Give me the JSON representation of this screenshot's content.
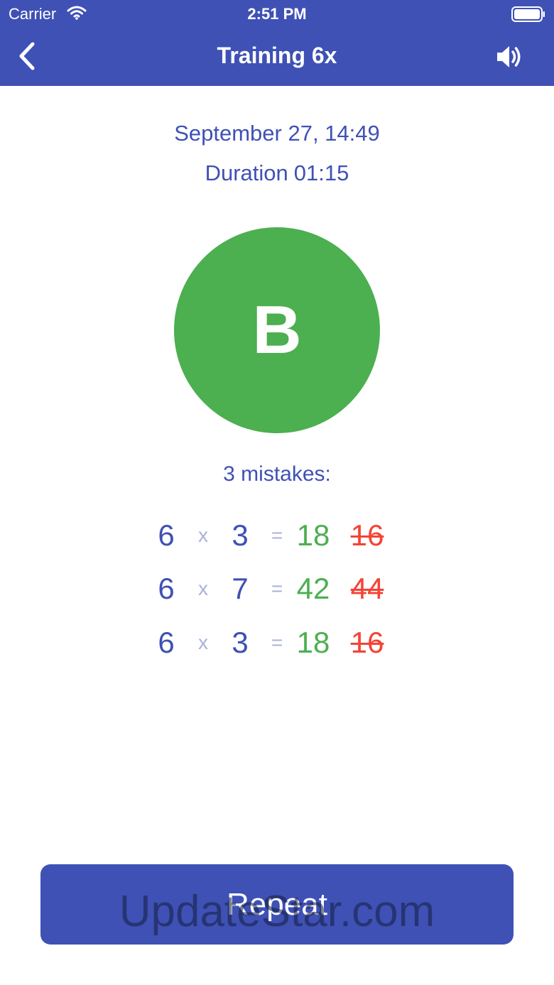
{
  "status_bar": {
    "carrier": "Carrier",
    "time": "2:51 PM"
  },
  "nav": {
    "title": "Training 6x",
    "back_icon": "chevron-left-icon",
    "sound_icon": "speaker-volume-icon"
  },
  "result": {
    "date": "September 27, 14:49",
    "duration_label": "Duration",
    "duration_value": "01:15",
    "grade": "B",
    "mistakes_label": "3 mistakes:"
  },
  "mistakes": [
    {
      "a": "6",
      "op": "x",
      "b": "3",
      "eq": "=",
      "correct": "18",
      "given": "16"
    },
    {
      "a": "6",
      "op": "x",
      "b": "7",
      "eq": "=",
      "correct": "42",
      "given": "44"
    },
    {
      "a": "6",
      "op": "x",
      "b": "3",
      "eq": "=",
      "correct": "18",
      "given": "16"
    }
  ],
  "actions": {
    "repeat_label": "Repeat"
  },
  "watermark": "UpdateStar.com",
  "colors": {
    "primary": "#3f51b5",
    "success": "#4caf50",
    "error": "#f44336",
    "muted": "#a9b0dc"
  }
}
